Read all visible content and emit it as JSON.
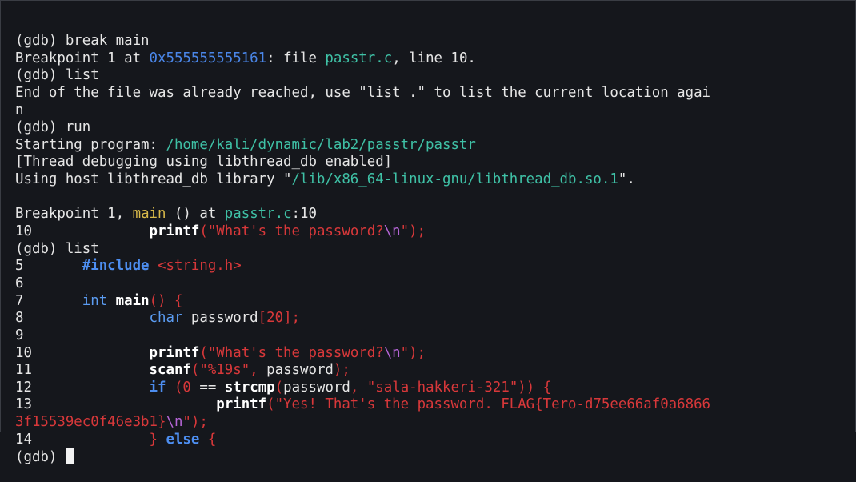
{
  "terminal": {
    "colors": {
      "background": "#15171c",
      "text": "#e6e6e6",
      "address": "#4a86e8",
      "filename": "#3fc1a6",
      "function": "#d8b94a",
      "string": "#d8383a",
      "escape": "#b565d6",
      "keyword": "#4d8ef0"
    },
    "lines": [
      [
        {
          "t": "(gdb) break main",
          "c": "def"
        }
      ],
      [
        {
          "t": "Breakpoint 1 at ",
          "c": "def"
        },
        {
          "t": "0x555555555161",
          "c": "addr"
        },
        {
          "t": ": file ",
          "c": "def"
        },
        {
          "t": "passtr.c",
          "c": "file"
        },
        {
          "t": ", line 10.",
          "c": "def"
        }
      ],
      [
        {
          "t": "(gdb) list",
          "c": "def"
        }
      ],
      [
        {
          "t": "End of the file was already reached, use \"list .\" to list the current location agai",
          "c": "def"
        }
      ],
      [
        {
          "t": "n",
          "c": "def"
        }
      ],
      [
        {
          "t": "(gdb) run",
          "c": "def"
        }
      ],
      [
        {
          "t": "Starting program: ",
          "c": "def"
        },
        {
          "t": "/home/kali/dynamic/lab2/passtr/passtr",
          "c": "file"
        }
      ],
      [
        {
          "t": "[Thread debugging using libthread_db enabled]",
          "c": "def"
        }
      ],
      [
        {
          "t": "Using host libthread_db library \"",
          "c": "def"
        },
        {
          "t": "/lib/x86_64-linux-gnu/libthread_db.so.1",
          "c": "file"
        },
        {
          "t": "\".",
          "c": "def"
        }
      ],
      [],
      [
        {
          "t": "Breakpoint 1, ",
          "c": "def"
        },
        {
          "t": "main",
          "c": "func"
        },
        {
          "t": " () at ",
          "c": "def"
        },
        {
          "t": "passtr.c",
          "c": "file"
        },
        {
          "t": ":10",
          "c": "def"
        }
      ],
      [
        {
          "t": "10\t\t",
          "c": "def"
        },
        {
          "t": "printf",
          "c": "fn"
        },
        {
          "t": "(\"What's the password?",
          "c": "str"
        },
        {
          "t": "\\n",
          "c": "esc"
        },
        {
          "t": "\");",
          "c": "str"
        }
      ],
      [
        {
          "t": "(gdb) list",
          "c": "def"
        }
      ],
      [
        {
          "t": "5\t",
          "c": "def"
        },
        {
          "t": "#include",
          "c": "prep"
        },
        {
          "t": " <string.h>",
          "c": "hdr"
        }
      ],
      [
        {
          "t": "6",
          "c": "def"
        }
      ],
      [
        {
          "t": "7\t",
          "c": "def"
        },
        {
          "t": "int",
          "c": "type"
        },
        {
          "t": " ",
          "c": "def"
        },
        {
          "t": "main",
          "c": "fn"
        },
        {
          "t": "() {",
          "c": "punc"
        }
      ],
      [
        {
          "t": "8\t\t",
          "c": "def"
        },
        {
          "t": "char",
          "c": "type"
        },
        {
          "t": " password",
          "c": "def"
        },
        {
          "t": "[20];",
          "c": "punc"
        }
      ],
      [
        {
          "t": "9",
          "c": "def"
        }
      ],
      [
        {
          "t": "10\t\t",
          "c": "def"
        },
        {
          "t": "printf",
          "c": "fn"
        },
        {
          "t": "(\"What's the password?",
          "c": "str"
        },
        {
          "t": "\\n",
          "c": "esc"
        },
        {
          "t": "\");",
          "c": "str"
        }
      ],
      [
        {
          "t": "11\t\t",
          "c": "def"
        },
        {
          "t": "scanf",
          "c": "fn"
        },
        {
          "t": "(\"%19s\", ",
          "c": "str"
        },
        {
          "t": "password",
          "c": "def"
        },
        {
          "t": ");",
          "c": "punc"
        }
      ],
      [
        {
          "t": "12\t\t",
          "c": "def"
        },
        {
          "t": "if",
          "c": "kw"
        },
        {
          "t": " (0 ",
          "c": "punc"
        },
        {
          "t": "==",
          "c": "def"
        },
        {
          "t": " ",
          "c": "def"
        },
        {
          "t": "strcmp",
          "c": "fn"
        },
        {
          "t": "(",
          "c": "punc"
        },
        {
          "t": "password",
          "c": "def"
        },
        {
          "t": ", \"sala-hakkeri-321\")) {",
          "c": "str"
        }
      ],
      [
        {
          "t": "13\t\t\t",
          "c": "def"
        },
        {
          "t": "printf",
          "c": "fn"
        },
        {
          "t": "(\"Yes! That's the password. FLAG{Tero-d75ee66af0a6866",
          "c": "str"
        }
      ],
      [
        {
          "t": "3f15539ec0f46e3b1}",
          "c": "str"
        },
        {
          "t": "\\n",
          "c": "esc"
        },
        {
          "t": "\");",
          "c": "str"
        }
      ],
      [
        {
          "t": "14\t\t",
          "c": "def"
        },
        {
          "t": "} ",
          "c": "punc"
        },
        {
          "t": "else",
          "c": "kw"
        },
        {
          "t": " {",
          "c": "punc"
        }
      ],
      [
        {
          "t": "(gdb) ",
          "c": "def"
        },
        {
          "t": "",
          "c": "cursor"
        }
      ]
    ]
  }
}
